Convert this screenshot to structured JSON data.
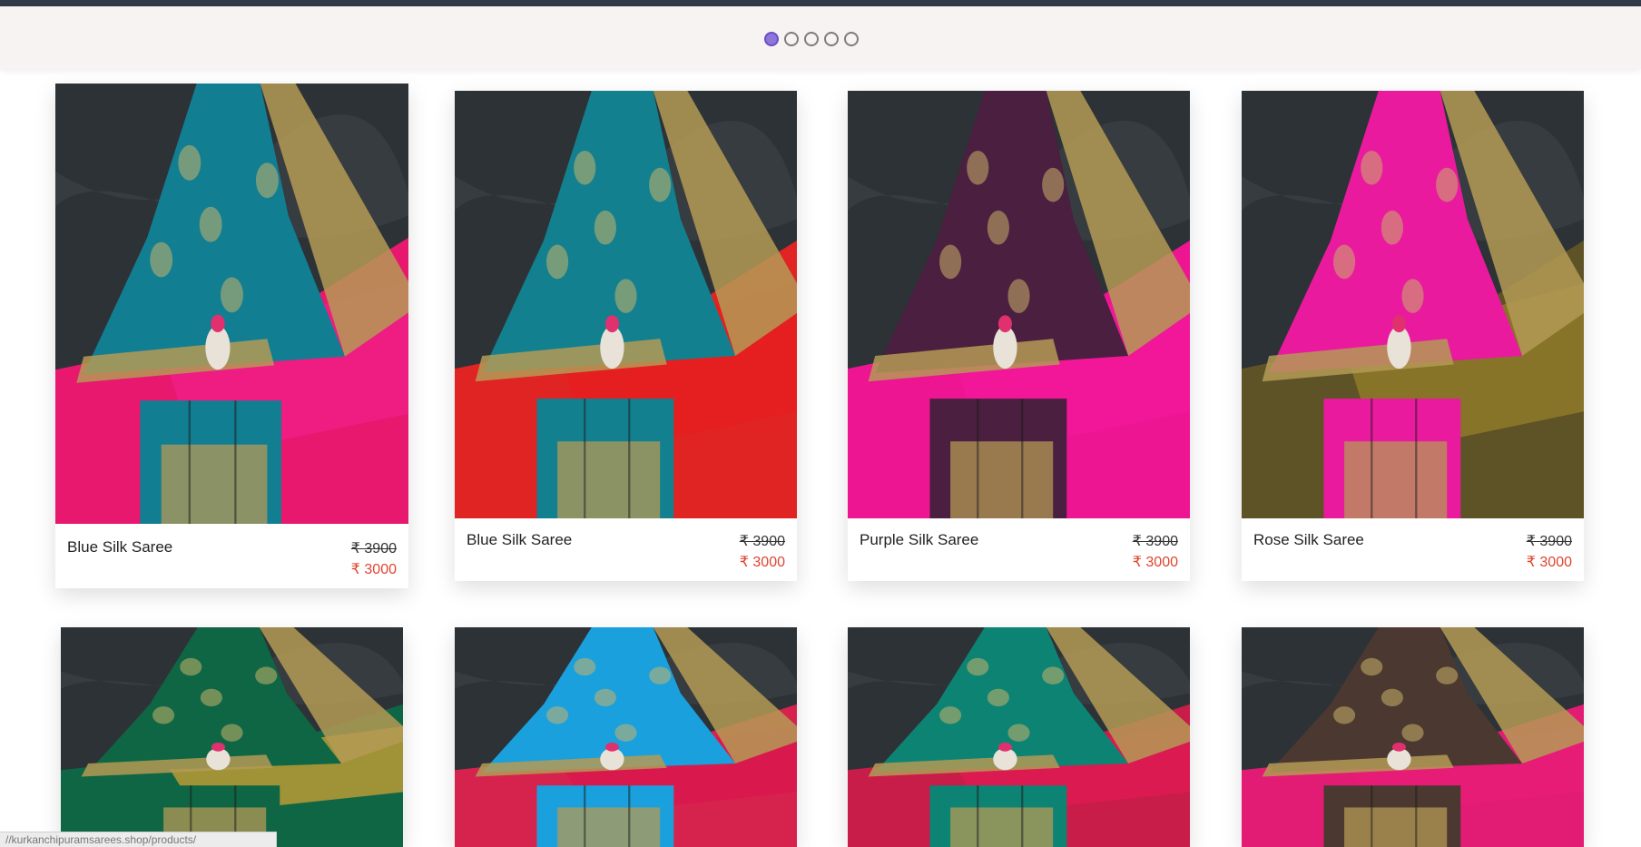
{
  "carousel": {
    "slides": 5,
    "active_index": 0
  },
  "colors": {
    "accent": "#8d76d9",
    "price_red": "#e0442f",
    "topbar": "#2f3a48"
  },
  "products": [
    {
      "name": "Blue Silk Saree",
      "mrp": "₹ 3900",
      "price": "₹ 3000",
      "main": "#127e92",
      "border": "#f01d86",
      "cloth": "#e8186f"
    },
    {
      "name": "Blue Silk Saree",
      "mrp": "₹ 3900",
      "price": "₹ 3000",
      "main": "#12808f",
      "border": "#e51f1f",
      "cloth": "#e02323"
    },
    {
      "name": "Purple Silk Saree",
      "mrp": "₹ 3900",
      "price": "₹ 3000",
      "main": "#4a1f3f",
      "border": "#f2169a",
      "cloth": "#ee1592"
    },
    {
      "name": "Rose Silk Saree",
      "mrp": "₹ 3900",
      "price": "₹ 3000",
      "main": "#ea1a9e",
      "border": "#8f7a2a",
      "cloth": "#5e5326"
    },
    {
      "name": "",
      "mrp": "",
      "price": "",
      "main": "#0f6645",
      "border": "#b99a35",
      "cloth": "#0f6645"
    },
    {
      "name": "",
      "mrp": "",
      "price": "",
      "main": "#1aa0dc",
      "border": "#d9184f",
      "cloth": "#d6234e"
    },
    {
      "name": "",
      "mrp": "",
      "price": "",
      "main": "#0d8374",
      "border": "#de1a52",
      "cloth": "#c81d49"
    },
    {
      "name": "",
      "mrp": "",
      "price": "",
      "main": "#4b3830",
      "border": "#e61c78",
      "cloth": "#e21b74"
    }
  ],
  "status_bar": {
    "url": "//kurkanchipuramsarees.shop/products/"
  }
}
